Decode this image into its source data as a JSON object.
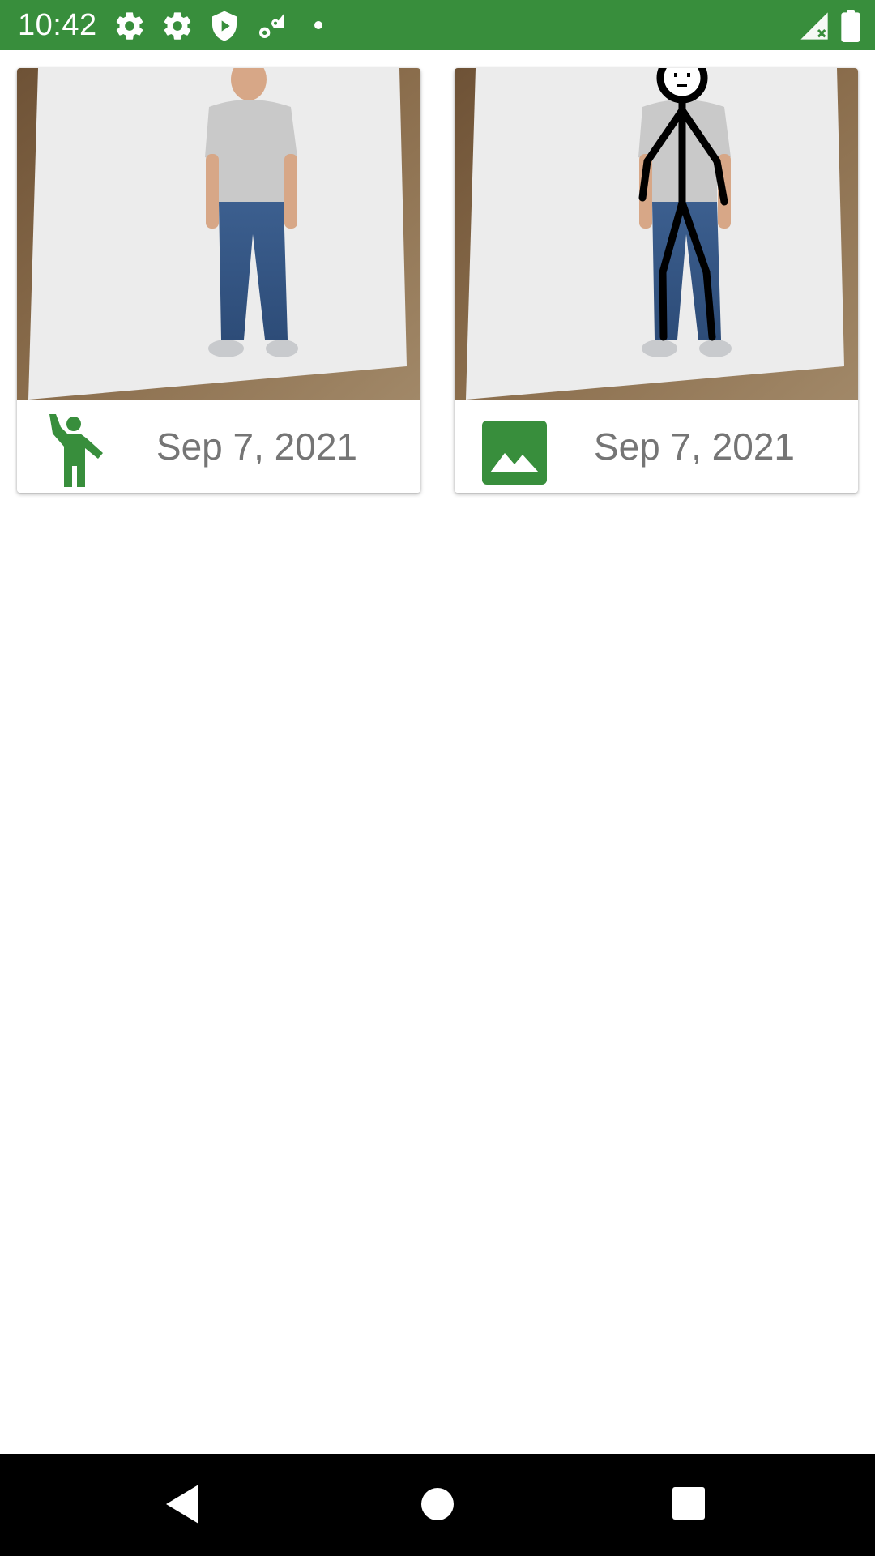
{
  "status_bar": {
    "time": "10:42",
    "background": "#388e3c",
    "icons": [
      "settings-icon",
      "settings-icon",
      "vpn-shield-play-icon",
      "gear-signal-icon",
      "notification-dot-icon",
      "no-signal-icon",
      "battery-icon"
    ]
  },
  "accent_color": "#388e3c",
  "cards": [
    {
      "date": "Sep 7, 2021",
      "icon": "person-waving-icon",
      "image": "photo of man in grey t-shirt and jeans"
    },
    {
      "date": "Sep 7, 2021",
      "icon": "image-icon",
      "image": "photo of man with stick figure overlay"
    }
  ],
  "nav_bar": {
    "buttons": [
      "back-button",
      "home-button",
      "recents-button"
    ]
  }
}
